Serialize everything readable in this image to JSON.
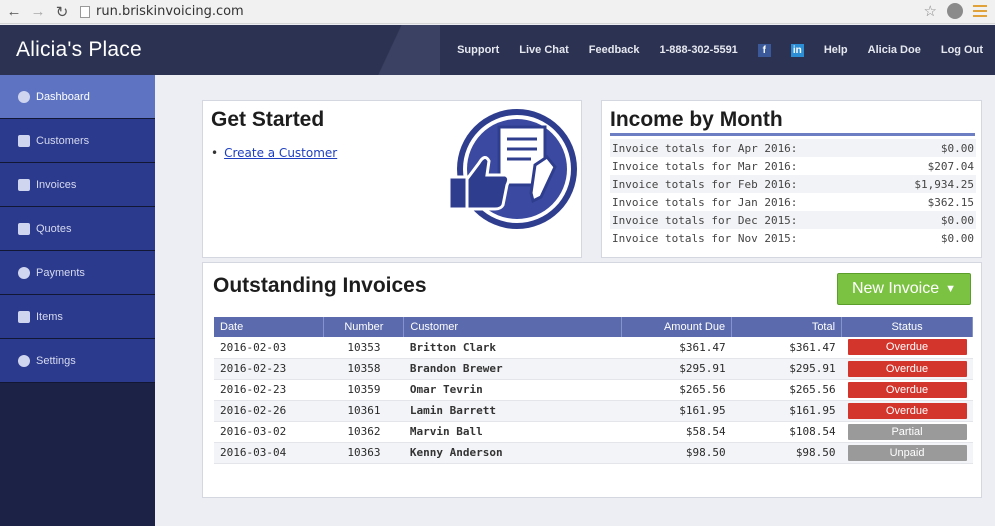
{
  "browser": {
    "url": "run.briskinvoicing.com"
  },
  "header": {
    "brand": "Alicia's Place",
    "nav": {
      "support": "Support",
      "live_chat": "Live Chat",
      "feedback": "Feedback",
      "phone": "1-888-302-5591",
      "help": "Help",
      "user": "Alicia Doe",
      "logout": "Log Out"
    }
  },
  "sidebar": {
    "items": [
      {
        "label": "Dashboard",
        "icon": "dashboard-icon"
      },
      {
        "label": "Customers",
        "icon": "customers-icon"
      },
      {
        "label": "Invoices",
        "icon": "invoices-icon"
      },
      {
        "label": "Quotes",
        "icon": "quotes-icon"
      },
      {
        "label": "Payments",
        "icon": "payments-icon"
      },
      {
        "label": "Items",
        "icon": "items-icon"
      },
      {
        "label": "Settings",
        "icon": "settings-icon"
      }
    ]
  },
  "get_started": {
    "title": "Get Started",
    "link": "Create a Customer"
  },
  "income": {
    "title": "Income by Month",
    "rows": [
      {
        "label": "Invoice totals for Apr 2016:",
        "value": "$0.00"
      },
      {
        "label": "Invoice totals for Mar 2016:",
        "value": "$207.04"
      },
      {
        "label": "Invoice totals for Feb 2016:",
        "value": "$1,934.25"
      },
      {
        "label": "Invoice totals for Jan 2016:",
        "value": "$362.15"
      },
      {
        "label": "Invoice totals for Dec 2015:",
        "value": "$0.00"
      },
      {
        "label": "Invoice totals for Nov 2015:",
        "value": "$0.00"
      }
    ]
  },
  "outstanding": {
    "title": "Outstanding Invoices",
    "new_button": "New Invoice",
    "columns": [
      "Date",
      "Number",
      "Customer",
      "Amount Due",
      "Total",
      "Status"
    ],
    "rows": [
      {
        "date": "2016-02-03",
        "number": "10353",
        "customer": "Britton Clark",
        "amount_due": "$361.47",
        "total": "$361.47",
        "status": "Overdue"
      },
      {
        "date": "2016-02-23",
        "number": "10358",
        "customer": "Brandon Brewer",
        "amount_due": "$295.91",
        "total": "$295.91",
        "status": "Overdue"
      },
      {
        "date": "2016-02-23",
        "number": "10359",
        "customer": "Omar Tevrin",
        "amount_due": "$265.56",
        "total": "$265.56",
        "status": "Overdue"
      },
      {
        "date": "2016-02-26",
        "number": "10361",
        "customer": "Lamin Barrett",
        "amount_due": "$161.95",
        "total": "$161.95",
        "status": "Overdue"
      },
      {
        "date": "2016-03-02",
        "number": "10362",
        "customer": "Marvin Ball",
        "amount_due": "$58.54",
        "total": "$108.54",
        "status": "Partial"
      },
      {
        "date": "2016-03-04",
        "number": "10363",
        "customer": "Kenny Anderson",
        "amount_due": "$98.50",
        "total": "$98.50",
        "status": "Unpaid"
      }
    ]
  },
  "colors": {
    "header_bg": "#2c3251",
    "sidebar_item": "#2b3a8c",
    "sidebar_active": "#5e74c2",
    "table_header": "#5a6aac",
    "overdue": "#d3342c",
    "partial": "#9a9a9a",
    "new_button": "#7cc242"
  }
}
